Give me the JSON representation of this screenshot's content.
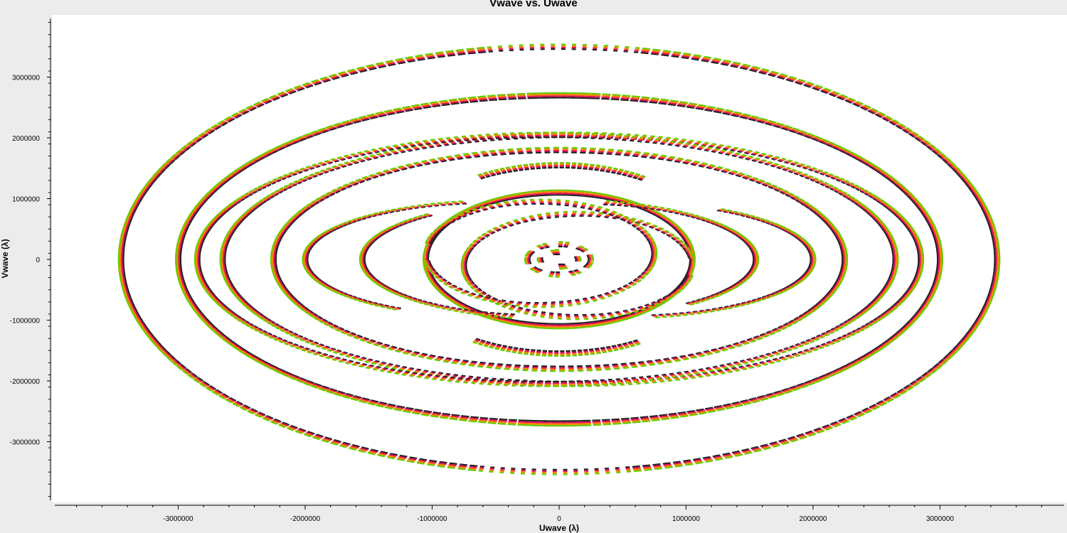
{
  "title": "Vwave vs. Uwave",
  "chart_data": {
    "type": "scatter",
    "title": "Vwave vs. Uwave",
    "xlabel": "Uwave (λ)",
    "ylabel": "Vwave (λ)",
    "xlim": [
      -3960000,
      3960000
    ],
    "ylim": [
      -3930000,
      4000000
    ],
    "x_ticks": [
      -3000000,
      -2000000,
      -1000000,
      0,
      1000000,
      2000000,
      3000000
    ],
    "x_tick_labels": [
      "-3000000",
      "-2000000",
      "-1000000",
      "0",
      "1000000",
      "2000000",
      "3000000"
    ],
    "y_ticks": [
      3000000,
      2000000,
      1000000,
      0,
      -1000000,
      -2000000,
      -3000000
    ],
    "y_tick_labels": [
      "3000000",
      "2000000",
      "1000000",
      "0",
      "-1000000",
      "-2000000",
      "-3000000"
    ],
    "grid": false,
    "series_colors": [
      "#222222",
      "#e0115f",
      "#ff7f00",
      "#66cc00"
    ],
    "tracks": [
      {
        "cx": 0,
        "cy": 0,
        "rx": 3450000,
        "ry": 3500000,
        "a0": 100,
        "a1": 440,
        "spacing": 5
      },
      {
        "cx": 0,
        "cy": 0,
        "rx": 3000000,
        "ry": 2700000,
        "a0": 85,
        "a1": 455,
        "spacing": 4.5
      },
      {
        "cx": 100000,
        "cy": 0,
        "rx": 2750000,
        "ry": 2050000,
        "a0": 0,
        "a1": 360,
        "spacing": 3.5
      },
      {
        "cx": 0,
        "cy": 0,
        "rx": 2250000,
        "ry": 1800000,
        "a0": 160,
        "a1": 520,
        "spacing": 4
      },
      {
        "cx": 0,
        "cy": 0,
        "rx": 1300000,
        "ry": 1550000,
        "a0": 60,
        "a1": 120,
        "spacing": 3
      },
      {
        "cx": 0,
        "cy": 0,
        "rx": 1300000,
        "ry": 1550000,
        "a0": 240,
        "a1": 300,
        "spacing": 3
      },
      {
        "cx": 0,
        "cy": 0,
        "rx": 1050000,
        "ry": 1100000,
        "a0": 0,
        "a1": 360,
        "spacing": 3.5
      },
      {
        "cx": 150000,
        "cy": -100000,
        "rx": 900000,
        "ry": 850000,
        "a0": 10,
        "a1": 350,
        "spacing": 4
      },
      {
        "cx": -100000,
        "cy": 0,
        "rx": 1450000,
        "ry": 950000,
        "a0": 130,
        "a1": 260,
        "spacing": 3
      },
      {
        "cx": 500000,
        "cy": 0,
        "rx": 1500000,
        "ry": 950000,
        "a0": 280,
        "a1": 420,
        "spacing": 3
      },
      {
        "cx": 0,
        "cy": 0,
        "rx": 250000,
        "ry": 250000,
        "a0": 0,
        "a1": 360,
        "spacing": 10
      },
      {
        "cx": 0,
        "cy": 0,
        "rx": 150000,
        "ry": 120000,
        "a0": 0,
        "a1": 330,
        "spacing": 14
      }
    ]
  }
}
